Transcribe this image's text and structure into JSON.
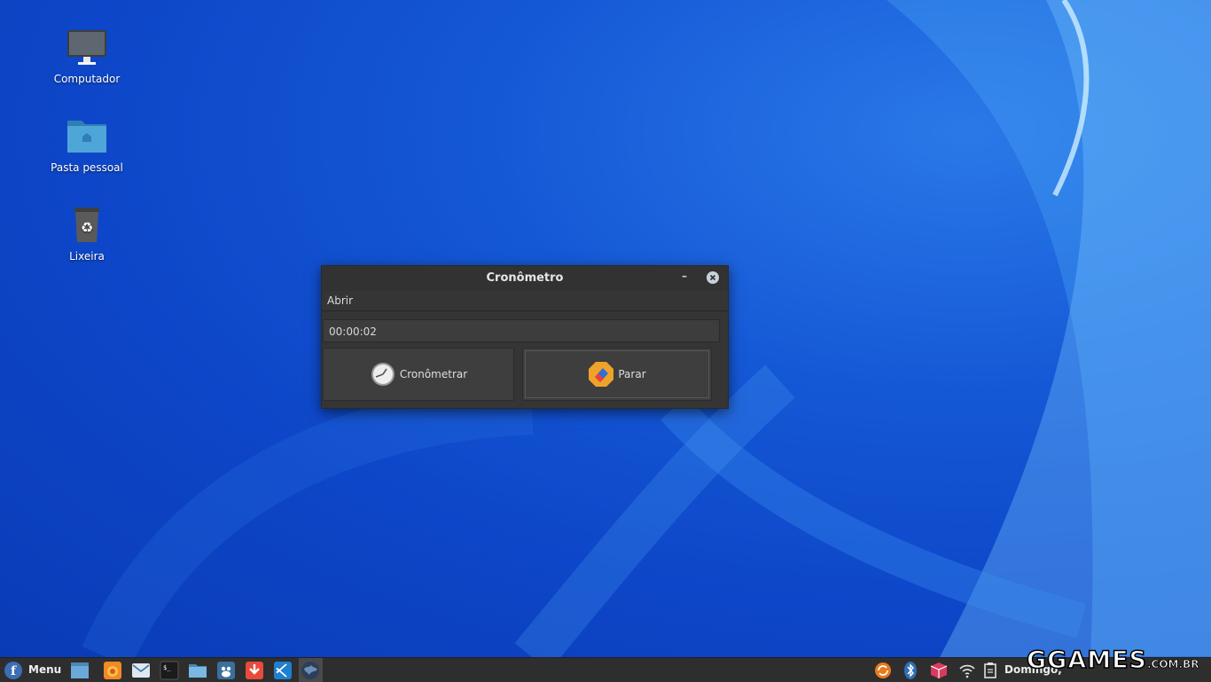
{
  "desktop": {
    "icons": [
      {
        "label": "Computador",
        "icon": "monitor-icon"
      },
      {
        "label": "Pasta pessoal",
        "icon": "home-folder-icon"
      },
      {
        "label": "Lixeira",
        "icon": "trash-icon"
      }
    ]
  },
  "window": {
    "title": "Cronômetro",
    "minimize_glyph": "–",
    "menu": {
      "open_label": "Abrir"
    },
    "time_value": "00:00:02",
    "start_button_label": "Cronômetrar",
    "stop_button_label": "Parar"
  },
  "taskbar": {
    "menu_label": "Menu",
    "launchers": [
      "files-icon",
      "firefox-icon",
      "mail-icon",
      "terminal-icon",
      "folder-icon",
      "gimp-icon",
      "download-icon",
      "vscode-icon",
      "globe-icon"
    ],
    "tray": [
      "updates-icon",
      "bluetooth-icon",
      "package-icon",
      "wifi-icon",
      "clipboard-icon"
    ],
    "clock_text": "Domingo,"
  },
  "watermark": {
    "main": "GGAMES",
    "suffix": ".COM.BR"
  },
  "colors": {
    "desktop_blue": "#1558d6",
    "window_bg": "#353535",
    "taskbar_bg": "#2e2e2e"
  }
}
